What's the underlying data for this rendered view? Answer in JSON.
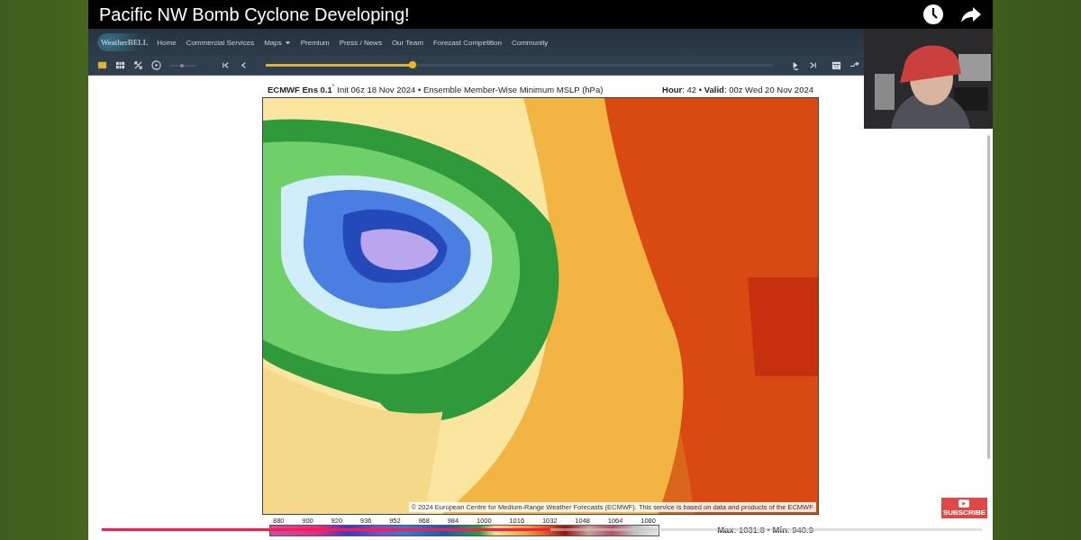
{
  "video": {
    "title": "Pacific NW Bomb Cyclone Developing!",
    "progress": {
      "level": 0.51
    },
    "subscribe": "SUBSCRIBE"
  },
  "site": {
    "logo": "WeatherBELL",
    "nav": [
      {
        "label": "Home",
        "dropdown": false
      },
      {
        "label": "Commercial Services",
        "dropdown": false
      },
      {
        "label": "Maps",
        "dropdown": true
      },
      {
        "label": "Premium",
        "dropdown": false
      },
      {
        "label": "Press / News",
        "dropdown": false
      },
      {
        "label": "Our Team",
        "dropdown": false
      },
      {
        "label": "Forecast Competition",
        "dropdown": false
      },
      {
        "label": "Community",
        "dropdown": false
      }
    ]
  },
  "toolbar": {
    "timeline": {
      "level": 0.29
    }
  },
  "map_panel": {
    "heading": "**ECMWF Ens 0.1**$^{°}$ Init 06z 18 Nov 2024 • Ensemble Member-Wise Minimum MSLP (hPa)",
    "valid": "**Hour**: 42 • **Valid**: 00z Wed 20 Nov 2024",
    "credit": "© 2024 European Centre for Medium-Range Weather Forecasts (ECMWF). This service is based on data and products of the ECMWF.",
    "scale": {
      "ticks": [
        "880",
        "900",
        "920",
        "936",
        "952",
        "968",
        "984",
        "1000",
        "1016",
        "1032",
        "1048",
        "1064",
        "1080"
      ],
      "summary": "**Max**: 1031.8 • **Min**: 940.9"
    }
  }
}
